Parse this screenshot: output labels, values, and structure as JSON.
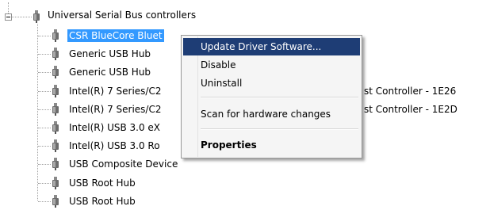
{
  "tree": {
    "category": {
      "label": "Universal Serial Bus controllers",
      "expander_icon": "minus-box-icon",
      "icon": "usb-plug-icon",
      "expanded": true
    },
    "devices": [
      {
        "label": "CSR BlueCore Bluet",
        "selected": true
      },
      {
        "label": "Generic USB Hub"
      },
      {
        "label": "Generic USB Hub"
      },
      {
        "label": "Intel(R) 7 Series/C2",
        "overflow": "st Controller - 1E26"
      },
      {
        "label": "Intel(R) 7 Series/C2",
        "overflow": "st Controller - 1E2D"
      },
      {
        "label": "Intel(R) USB 3.0 eX"
      },
      {
        "label": "Intel(R) USB 3.0 Ro"
      },
      {
        "label": "USB Composite Device"
      },
      {
        "label": "USB Root Hub"
      },
      {
        "label": "USB Root Hub"
      }
    ]
  },
  "context_menu": {
    "items": [
      {
        "label": "Update Driver Software...",
        "highlighted": true
      },
      {
        "label": "Disable"
      },
      {
        "label": "Uninstall"
      },
      {
        "label": "Scan for hardware changes"
      },
      {
        "label": "Properties",
        "bold": true
      }
    ]
  },
  "colors": {
    "selection": "#3399ff",
    "menu_highlight": "#1e3d75",
    "menu_background": "#f5f5f5",
    "tree_lines": "#a0a0a0"
  }
}
